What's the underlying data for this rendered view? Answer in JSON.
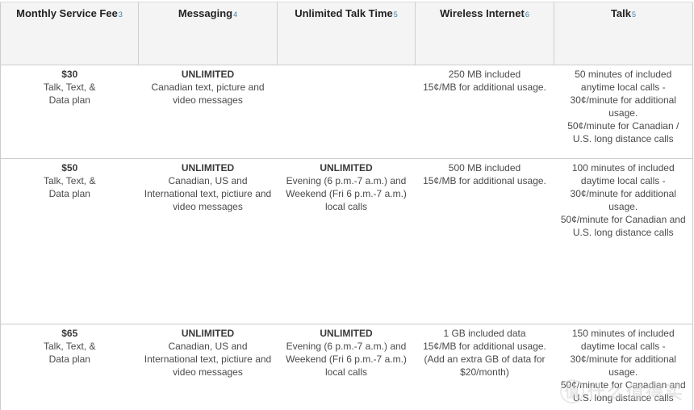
{
  "table": {
    "headers": [
      {
        "label": "Monthly Service Fee",
        "footnote": "3"
      },
      {
        "label": "Messaging",
        "footnote": "4"
      },
      {
        "label": "Unlimited Talk Time",
        "footnote": "5"
      },
      {
        "label": "Wireless Internet",
        "footnote": "6"
      },
      {
        "label": "Talk",
        "footnote": "5"
      }
    ],
    "rows": [
      {
        "fee": {
          "price": "$30",
          "lines": [
            "Talk, Text, &",
            "Data plan"
          ]
        },
        "messaging": {
          "title": "UNLIMITED",
          "lines": [
            "Canadian text, picture and",
            "video messages"
          ]
        },
        "talk_time": {
          "title": "",
          "lines": []
        },
        "internet": {
          "lines": [
            "250 MB included",
            "15¢/MB for additional usage."
          ]
        },
        "talk": {
          "lines": [
            "50 minutes of included",
            "anytime local calls -",
            "30¢/minute for additional",
            "usage.",
            "50¢/minute for Canadian /",
            "U.S. long distance calls"
          ]
        }
      },
      {
        "fee": {
          "price": "$50",
          "lines": [
            "Talk, Text, &",
            "Data plan"
          ]
        },
        "messaging": {
          "title": "UNLIMITED",
          "lines": [
            "Canadian, US and",
            "International text, pictiure and",
            "video messages"
          ]
        },
        "talk_time": {
          "title": "UNLIMITED",
          "lines": [
            "Evening (6 p.m.-7 a.m.) and",
            "Weekend (Fri 6 p.m.-7 a.m.)",
            "local calls"
          ]
        },
        "internet": {
          "lines": [
            "500 MB included",
            "15¢/MB for additional usage."
          ]
        },
        "talk": {
          "lines": [
            "100 minutes of included",
            "daytime local calls -",
            "30¢/minute for additional",
            "usage.",
            "50¢/minute for Canadian and",
            "U.S. long distance calls"
          ]
        }
      },
      {
        "fee": {
          "price": "$65",
          "lines": [
            "Talk, Text, &",
            "Data plan"
          ]
        },
        "messaging": {
          "title": "UNLIMITED",
          "lines": [
            "Canadian, US and",
            "International text, pictiure and",
            "video messages"
          ]
        },
        "talk_time": {
          "title": "UNLIMITED",
          "lines": [
            "Evening (6 p.m.-7 a.m.) and",
            "Weekend (Fri 6 p.m.-7 a.m.)",
            "local calls"
          ]
        },
        "internet": {
          "lines": [
            "1 GB included data",
            "15¢/MB for additional usage.",
            "(Add an extra GB of data for",
            "$20/month)"
          ]
        },
        "talk": {
          "lines": [
            "150 minutes of included",
            "daytime local calls -",
            "30¢/minute for additional",
            "usage.",
            "50¢/minute for Canadian and",
            "U.S. long distance calls"
          ]
        }
      }
    ]
  },
  "watermark": {
    "badge": "值",
    "text": "什么值得买"
  },
  "colors": {
    "header_bg": "#f4f4f4",
    "footnote": "#3a7fae",
    "border": "#cccccc",
    "text": "#4a4a4a"
  }
}
